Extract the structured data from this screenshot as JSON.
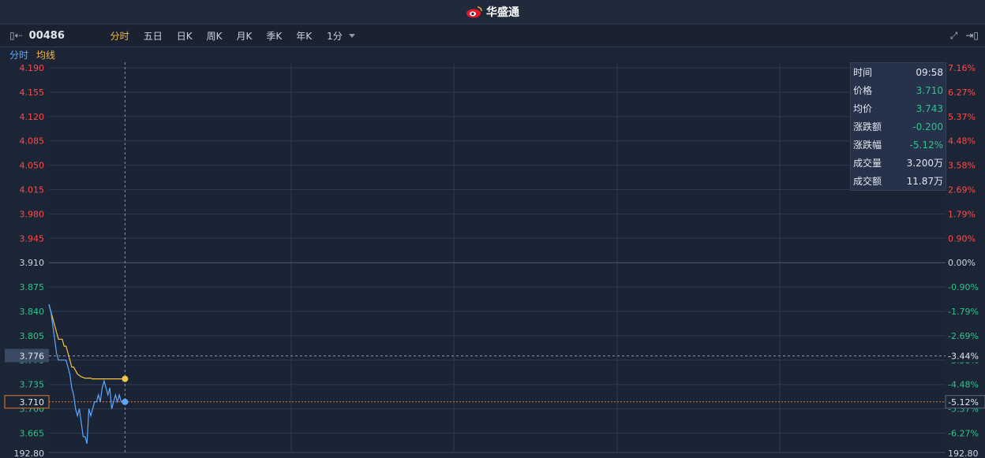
{
  "header": {
    "brand": "华盛通"
  },
  "toolbar": {
    "stock_code": "00486",
    "tabs": [
      {
        "label": "分时",
        "active": true
      },
      {
        "label": "五日",
        "active": false
      },
      {
        "label": "日K",
        "active": false
      },
      {
        "label": "周K",
        "active": false
      },
      {
        "label": "月K",
        "active": false
      },
      {
        "label": "季K",
        "active": false
      },
      {
        "label": "年K",
        "active": false
      }
    ],
    "period": "1分"
  },
  "legend": {
    "price_line": "分时",
    "avg_line": "均线"
  },
  "info": [
    {
      "key": "时间",
      "value": "09:58",
      "status": "neutral"
    },
    {
      "key": "价格",
      "value": "3.710",
      "status": "down"
    },
    {
      "key": "均价",
      "value": "3.743",
      "status": "down"
    },
    {
      "key": "涨跌额",
      "value": "-0.200",
      "status": "down"
    },
    {
      "key": "涨跌幅",
      "value": "-5.12%",
      "status": "down"
    },
    {
      "key": "成交量",
      "value": "3.200万",
      "status": "neutral"
    },
    {
      "key": "成交额",
      "value": "11.87万",
      "status": "neutral"
    }
  ],
  "colors": {
    "up": "#ff4a4a",
    "down": "#2fc28c",
    "neutral": "#d0d6df",
    "price_line": "#5aa9ff",
    "avg_line": "#f5c542",
    "grid": "#2c3a50",
    "crosshair_label_bg": "#3a4a62",
    "current_price_border": "#e07a2c"
  },
  "chart_data": {
    "type": "line",
    "prev_close": 3.91,
    "ylim": [
      3.63,
      4.2
    ],
    "y_ticks": [
      {
        "price": "4.190",
        "pct": "7.16%",
        "trend": "up"
      },
      {
        "price": "4.155",
        "pct": "6.27%",
        "trend": "up"
      },
      {
        "price": "4.120",
        "pct": "5.37%",
        "trend": "up"
      },
      {
        "price": "4.085",
        "pct": "4.48%",
        "trend": "up"
      },
      {
        "price": "4.050",
        "pct": "3.58%",
        "trend": "up"
      },
      {
        "price": "4.015",
        "pct": "2.69%",
        "trend": "up"
      },
      {
        "price": "3.980",
        "pct": "1.79%",
        "trend": "up"
      },
      {
        "price": "3.945",
        "pct": "0.90%",
        "trend": "up"
      },
      {
        "price": "3.910",
        "pct": "0.00%",
        "trend": "flat"
      },
      {
        "price": "3.875",
        "pct": "-0.90%",
        "trend": "down"
      },
      {
        "price": "3.840",
        "pct": "-1.79%",
        "trend": "down"
      },
      {
        "price": "3.805",
        "pct": "-2.69%",
        "trend": "down"
      },
      {
        "price": "3.770",
        "pct": "-3.58%",
        "trend": "down"
      },
      {
        "price": "3.735",
        "pct": "-4.48%",
        "trend": "down"
      },
      {
        "price": "3.700",
        "pct": "-5.37%",
        "trend": "down"
      },
      {
        "price": "3.665",
        "pct": "-6.27%",
        "trend": "down"
      }
    ],
    "crosshair": {
      "price": "3.776",
      "pct": "-3.44%"
    },
    "current": {
      "price": "3.710",
      "pct": "-5.12%"
    },
    "volume_axis": "192.80",
    "total_minutes": 330,
    "crosshair_minute": 28,
    "series": [
      {
        "name": "分时",
        "values": [
          3.85,
          3.84,
          3.82,
          3.8,
          3.78,
          3.77,
          3.77,
          3.77,
          3.77,
          3.77,
          3.76,
          3.75,
          3.73,
          3.72,
          3.7,
          3.69,
          3.7,
          3.68,
          3.66,
          3.66,
          3.65,
          3.7,
          3.69,
          3.7,
          3.71,
          3.71,
          3.72,
          3.71,
          3.73,
          3.74,
          3.73,
          3.72,
          3.73,
          3.7,
          3.71,
          3.72,
          3.71,
          3.72,
          3.71,
          3.71
        ]
      },
      {
        "name": "均线",
        "values": [
          3.85,
          3.84,
          3.83,
          3.82,
          3.81,
          3.8,
          3.8,
          3.8,
          3.79,
          3.79,
          3.78,
          3.77,
          3.76,
          3.76,
          3.755,
          3.75,
          3.748,
          3.746,
          3.745,
          3.744,
          3.744,
          3.744,
          3.744,
          3.743,
          3.743,
          3.743,
          3.743,
          3.743,
          3.743,
          3.743,
          3.743,
          3.743,
          3.743,
          3.743,
          3.743,
          3.743,
          3.743,
          3.743,
          3.743,
          3.743
        ]
      }
    ]
  }
}
